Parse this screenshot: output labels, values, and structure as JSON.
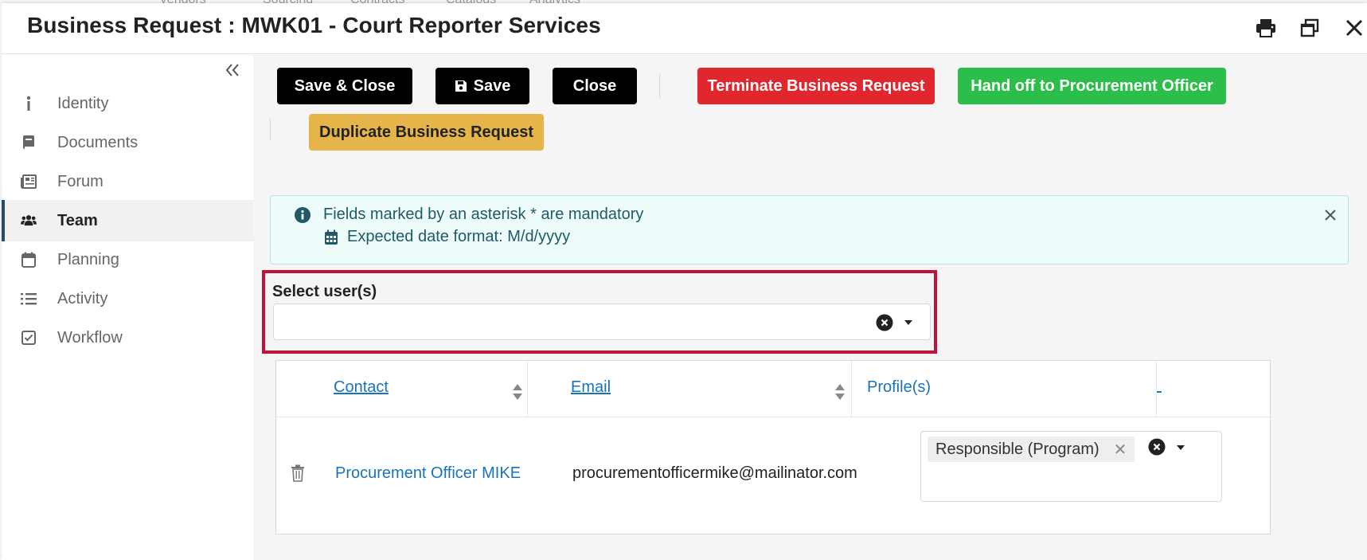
{
  "background_nav": [
    "Vendors",
    "Sourcing",
    "Contracts",
    "Catalogs",
    "Analytics"
  ],
  "header": {
    "title": "Business Request : MWK01 - Court Reporter Services"
  },
  "sidebar": {
    "items": [
      {
        "label": "Identity",
        "icon": "info-icon"
      },
      {
        "label": "Documents",
        "icon": "book-icon"
      },
      {
        "label": "Forum",
        "icon": "newspaper-icon"
      },
      {
        "label": "Team",
        "icon": "users-icon",
        "active": true
      },
      {
        "label": "Planning",
        "icon": "calendar-icon"
      },
      {
        "label": "Activity",
        "icon": "list-icon"
      },
      {
        "label": "Workflow",
        "icon": "checkbox-icon"
      }
    ]
  },
  "toolbar": {
    "save_close": "Save & Close",
    "save": "Save",
    "close": "Close",
    "terminate": "Terminate Business Request",
    "handoff": "Hand off to Procurement Officer",
    "duplicate": "Duplicate Business Request"
  },
  "info": {
    "mandatory": "Fields marked by an asterisk * are mandatory",
    "date_format": "Expected date format: M/d/yyyy"
  },
  "select_users": {
    "label": "Select user(s)",
    "value": ""
  },
  "table": {
    "headers": {
      "contact": "Contact",
      "email": "Email",
      "profiles": "Profile(s)"
    },
    "rows": [
      {
        "contact": "Procurement Officer MIKE",
        "email": "procurementofficermike@mailinator.com",
        "profiles": [
          "Responsible (Program)"
        ]
      }
    ]
  },
  "colors": {
    "primary_black": "#000000",
    "danger_red": "#e1262d",
    "success_green": "#2cbe4a",
    "warning_gold": "#e5b54a",
    "link_blue": "#1874b8",
    "highlight_crimson": "#c0123b",
    "info_bg": "#eefbfb"
  }
}
